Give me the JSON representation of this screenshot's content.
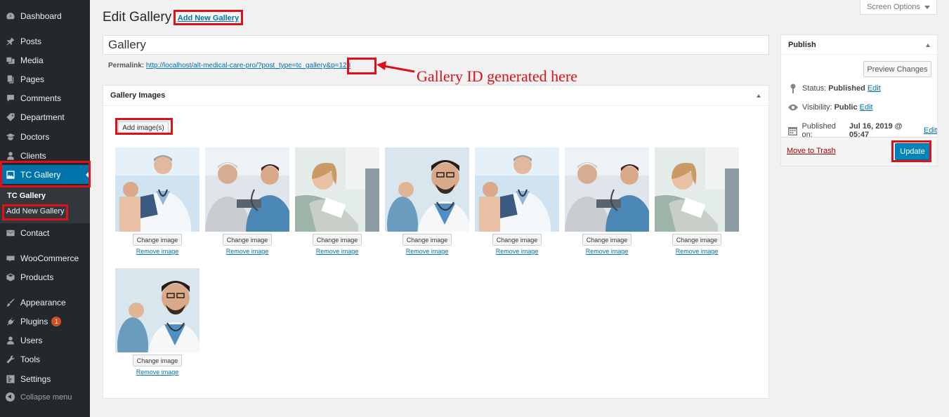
{
  "sidebar": {
    "items": [
      {
        "label": "Dashboard",
        "icon": "dashboard-icon"
      },
      {
        "label": "Posts",
        "icon": "pin-icon"
      },
      {
        "label": "Media",
        "icon": "media-icon"
      },
      {
        "label": "Pages",
        "icon": "pages-icon"
      },
      {
        "label": "Comments",
        "icon": "comment-icon"
      },
      {
        "label": "Department",
        "icon": "tag-icon"
      },
      {
        "label": "Doctors",
        "icon": "mortarboard-icon"
      },
      {
        "label": "Clients",
        "icon": "user-icon"
      },
      {
        "label": "TC Gallery",
        "icon": "gallery-icon"
      },
      {
        "label": "Contact",
        "icon": "envelope-icon"
      },
      {
        "label": "WooCommerce",
        "icon": "woo-icon"
      },
      {
        "label": "Products",
        "icon": "box-icon"
      },
      {
        "label": "Appearance",
        "icon": "brush-icon"
      },
      {
        "label": "Plugins",
        "icon": "plug-icon",
        "badge": "1"
      },
      {
        "label": "Users",
        "icon": "users-icon"
      },
      {
        "label": "Tools",
        "icon": "wrench-icon"
      },
      {
        "label": "Settings",
        "icon": "settings-icon"
      }
    ],
    "submenu": {
      "current": "TC Gallery",
      "add_new": "Add New Gallery"
    },
    "collapse": "Collapse menu"
  },
  "header": {
    "title": "Edit Gallery",
    "add_new": "Add New Gallery",
    "screen_options": "Screen Options"
  },
  "post": {
    "title": "Gallery",
    "permalink_label": "Permalink:",
    "permalink_url": "http://localhost/alt-medical-care-pro/?post_type=tc_gallery&p=123"
  },
  "annotation": {
    "text": "Gallery ID generated here",
    "color": "#d9111a"
  },
  "gallery": {
    "heading": "Gallery Images",
    "add_button": "Add image(s)",
    "change_label": "Change image",
    "remove_label": "Remove image",
    "images": [
      "doctor-with-clipboard",
      "doctor-checking-blood-pressure",
      "smiling-patient-in-dental-chair",
      "smiling-doctor-with-stethoscope",
      "doctor-with-clipboard",
      "doctor-checking-blood-pressure",
      "smiling-patient-in-dental-chair",
      "smiling-doctor-with-stethoscope"
    ]
  },
  "publish": {
    "heading": "Publish",
    "preview": "Preview Changes",
    "status_label": "Status:",
    "status_value": "Published",
    "visibility_label": "Visibility:",
    "visibility_value": "Public",
    "published_label": "Published on:",
    "published_value": "Jul 16, 2019 @ 05:47",
    "edit": "Edit",
    "trash": "Move to Trash",
    "update": "Update"
  },
  "colors": {
    "accent": "#0073aa",
    "highlight": "#e20e18",
    "sidebar": "#23282d"
  }
}
